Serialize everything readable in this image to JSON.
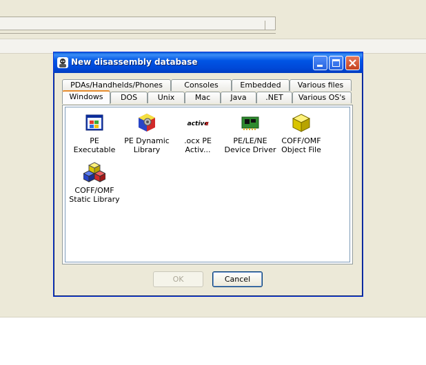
{
  "dialog": {
    "title": "New disassembly database",
    "ok_label": "OK",
    "cancel_label": "Cancel"
  },
  "tabs_row1": [
    {
      "label": "PDAs/Handhelds/Phones"
    },
    {
      "label": "Consoles"
    },
    {
      "label": "Embedded"
    },
    {
      "label": "Various files"
    }
  ],
  "tabs_row2": [
    {
      "label": "Windows",
      "active": true
    },
    {
      "label": "DOS"
    },
    {
      "label": "Unix"
    },
    {
      "label": "Mac"
    },
    {
      "label": "Java"
    },
    {
      "label": ".NET"
    },
    {
      "label": "Various OS's"
    }
  ],
  "items": [
    {
      "line1": "PE Executable",
      "line2": "",
      "icon": "pe-executable-icon"
    },
    {
      "line1": "PE Dynamic",
      "line2": "Library",
      "icon": "pe-dll-icon"
    },
    {
      "line1": ".ocx PE",
      "line2": "Activ...",
      "icon": "activex-icon"
    },
    {
      "line1": "PE/LE/NE",
      "line2": "Device Driver",
      "icon": "device-driver-icon"
    },
    {
      "line1": "COFF/OMF",
      "line2": "Object File",
      "icon": "object-file-icon"
    },
    {
      "line1": "COFF/OMF",
      "line2": "Static Library",
      "icon": "static-library-icon"
    }
  ],
  "colors": {
    "titlebar": "#0055e5",
    "tab_active_accent": "#e68b2c"
  }
}
